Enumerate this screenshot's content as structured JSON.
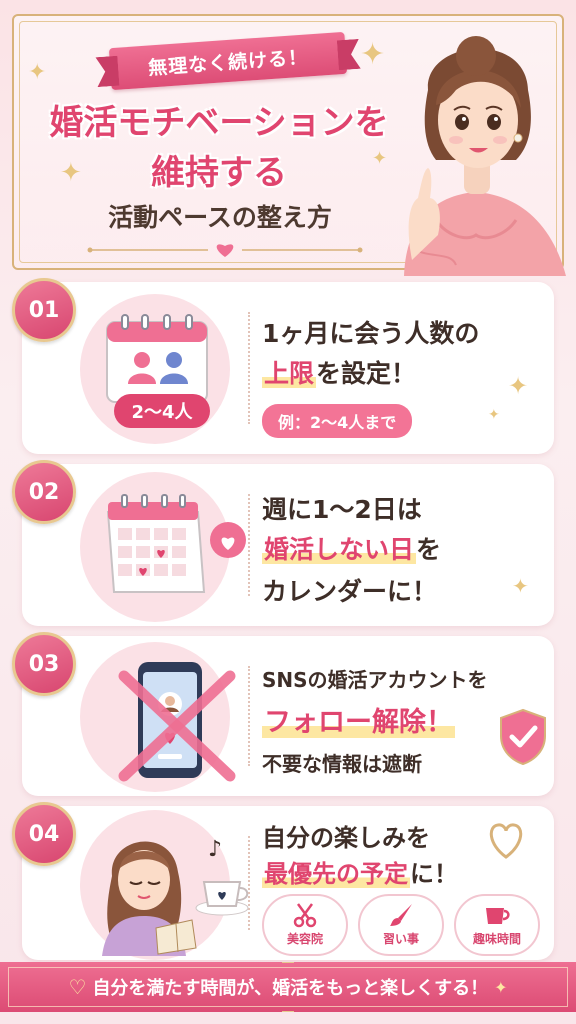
{
  "header": {
    "ribbon": "無理なく続ける！",
    "title_line1": "婚活モチベーションを",
    "title_line2": "維持する",
    "subtitle": "活動ペースの整え方"
  },
  "tips": [
    {
      "number": "01",
      "line1": "1ヶ月に会う人数の",
      "line2_highlight": "上限",
      "line2_rest": "を設定！",
      "example": "例：2〜4人まで",
      "badge": "2〜4人"
    },
    {
      "number": "02",
      "line1": "週に1〜2日は",
      "line2_highlight": "婚活しない日",
      "line2_rest": "を",
      "line3": "カレンダーに！"
    },
    {
      "number": "03",
      "line1": "SNSの婚活アカウントを",
      "line2_highlight": "フォロー解除！",
      "line3": "不要な情報は遮断"
    },
    {
      "number": "04",
      "line1": "自分の楽しみを",
      "line2_highlight": "最優先の予定",
      "line2_rest": "に！",
      "examples": [
        {
          "label": "美容院",
          "icon": "scissors-icon"
        },
        {
          "label": "習い事",
          "icon": "brush-icon"
        },
        {
          "label": "趣味時間",
          "icon": "coffee-cup-icon"
        }
      ]
    }
  ],
  "footer": {
    "text": "自分を満たす時間が、婚活をもっと楽しくする！"
  },
  "colors": {
    "accent_pink": "#e0456f",
    "ribbon_pink": "#ef6f93",
    "gold": "#d8b27a",
    "highlight_yellow": "#fde7a2"
  }
}
